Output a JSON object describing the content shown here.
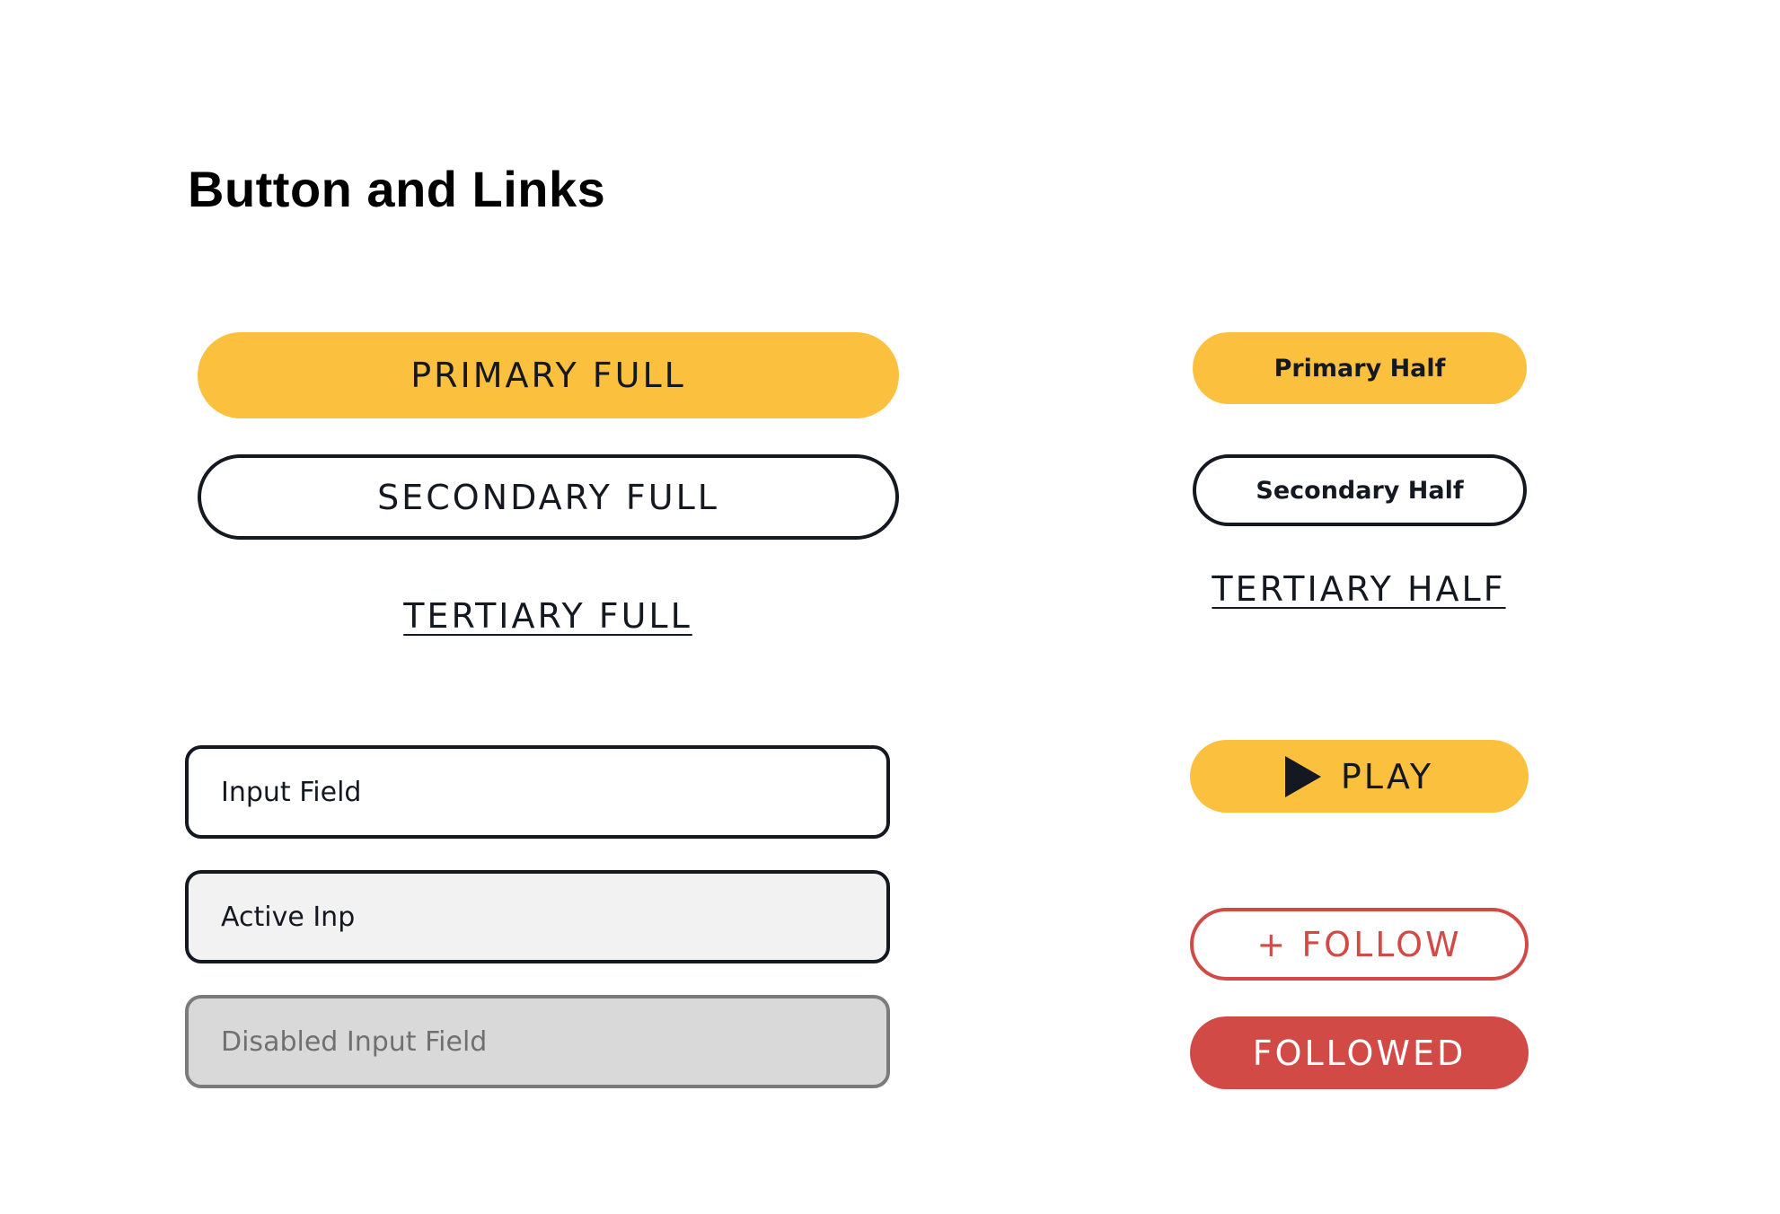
{
  "heading": "Button and Links",
  "buttons_full": {
    "primary": "PRIMARY FULL",
    "secondary": "SECONDARY FULL",
    "tertiary": "TERTIARY FULL"
  },
  "buttons_half": {
    "primary": "Primary Half",
    "secondary": "Secondary Half",
    "tertiary": "TERTIARY HALF"
  },
  "inputs": {
    "default_placeholder": "Input Field",
    "active_value": "Active Inp",
    "disabled_placeholder": "Disabled Input Field"
  },
  "actions": {
    "play_label": "PLAY",
    "play_icon": "play-icon",
    "follow_label": "+ FOLLOW",
    "followed_label": "FOLLOWED"
  },
  "colors": {
    "primary": "#fbc03d",
    "dark": "#141821",
    "follow_red": "#d24a46",
    "active_input_bg": "#f2f2f2",
    "disabled_input_bg": "#d9d9d9",
    "disabled_border": "#7b7b7b"
  }
}
